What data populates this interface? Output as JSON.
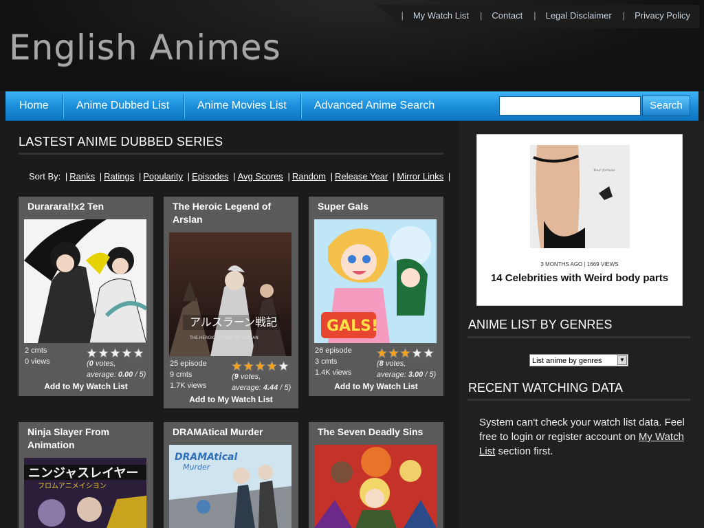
{
  "header": {
    "logo": "English Animes",
    "toplinks": [
      "My Watch List",
      "Contact",
      "Legal Disclaimer",
      "Privacy Policy"
    ]
  },
  "nav": {
    "items": [
      "Home",
      "Anime Dubbed List",
      "Anime Movies List",
      "Advanced Anime Search"
    ],
    "search_value": "",
    "search_button": "Search"
  },
  "main": {
    "section_title": "LASTEST ANIME DUBBED SERIES",
    "sort_label": "Sort By:",
    "sort_links": [
      "Ranks",
      "Ratings",
      "Popularity",
      "Episodes",
      "Avg Scores",
      "Random",
      "Release Year",
      "Mirror Links"
    ],
    "add_label": "Add to My Watch List",
    "cards": [
      {
        "title": "Durarara!!x2 Ten",
        "episode": "",
        "comments": "2 cmts",
        "views": "0 views",
        "votes": "0",
        "votes_label": "votes,",
        "average": "0.00",
        "average_label": "average:",
        "out_of": "/ 5",
        "stars": 0
      },
      {
        "title": "The Heroic Legend of Arslan",
        "episode": "25 episode",
        "comments": "9 cmts",
        "views": "1.7K views",
        "votes": "9",
        "votes_label": "votes,",
        "average": "4.44",
        "average_label": "average:",
        "out_of": "/ 5",
        "stars": 4.44
      },
      {
        "title": "Super Gals",
        "episode": "26 episode",
        "comments": "3 cmts",
        "views": "1.4K views",
        "votes": "8",
        "votes_label": "votes,",
        "average": "3.00",
        "average_label": "average:",
        "out_of": "/ 5",
        "stars": 3
      },
      {
        "title": "Ninja Slayer From Animation"
      },
      {
        "title": "DRAMAtical Murder"
      },
      {
        "title": "The Seven Deadly Sins"
      }
    ]
  },
  "sidebar": {
    "ad_meta": "3 MONTHS AGO | 1669 VIEWS",
    "ad_headline": "14 Celebrities with Weird body parts",
    "genres_title": "ANIME LIST BY GENRES",
    "genres_select": "List anime by genres",
    "recent_title": "RECENT WATCHING DATA",
    "recent_text_1": "System can't check your watch list data. Feel free to login or register account on",
    "recent_link": "My Watch List",
    "recent_text_2": "section first."
  },
  "colors": {
    "nav_blue": "#1b8fdb",
    "card_bg": "#5a5a5a",
    "star": "#f4a21a"
  }
}
